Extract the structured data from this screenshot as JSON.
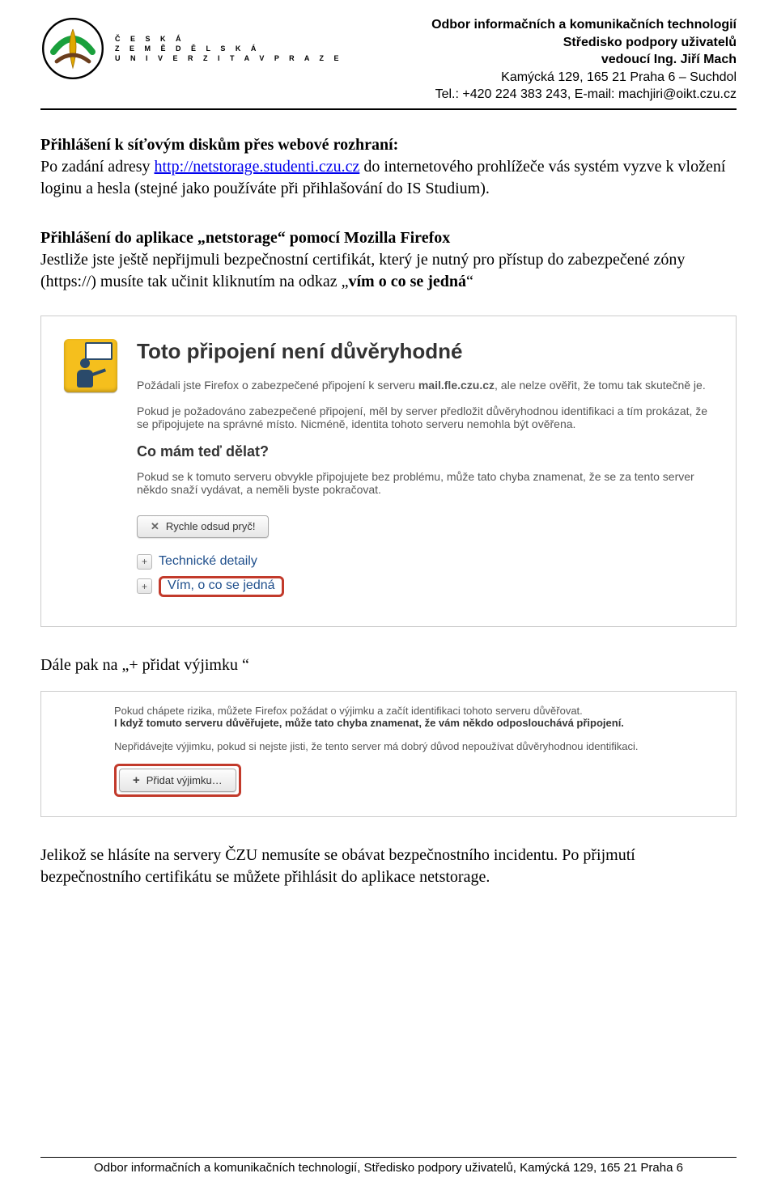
{
  "header": {
    "logo_text_line1": "Č E S K Á",
    "logo_text_line2": "Z E M Ě D Ě L S K Á",
    "logo_text_line3": "U N I V E R Z I T A  V  P R A Z E",
    "right_line1": "Odbor informačních a komunikačních technologií",
    "right_line2": "Středisko podpory uživatelů",
    "right_line3": "vedoucí Ing. Jiří Mach",
    "right_line4": "Kamýcká 129, 165 21  Praha 6 – Suchdol",
    "right_line5": "Tel.: +420 224 383 243, E-mail: machjiri@oikt.czu.cz"
  },
  "section1": {
    "title": "Přihlášení k síťovým diskům přes webové rozhraní:",
    "p1_pre": "Po zadání adresy ",
    "p1_link": "http://netstorage.studenti.czu.cz",
    "p1_post": " do internetového prohlížeče vás systém vyzve k vložení loginu a hesla (stejné jako používáte při přihlašování do IS Studium)."
  },
  "section2": {
    "title": "Přihlášení do aplikace „netstorage“ pomocí Mozilla Firefox",
    "p1_pre": "Jestliže jste ještě nepřijmuli bezpečnostní certifikát, který je nutný pro přístup do zabezpečené zóny (https://) musíte tak učinit kliknutím na odkaz „",
    "p1_bold": "vím o co se jedná",
    "p1_post": "“"
  },
  "warning": {
    "title": "Toto připojení není důvěryhodné",
    "p1_a": "Požádali jste Firefox o zabezpečené připojení k serveru ",
    "p1_server": "mail.fle.czu.cz",
    "p1_b": ", ale nelze ověřit, že tomu tak skutečně je.",
    "p2": "Pokud je požadováno zabezpečené připojení, měl by server předložit důvěryhodnou identifikaci a tím prokázat, že se připojujete na správné místo. Nicméně, identita tohoto serveru nemohla být ověřena.",
    "sub1": "Co mám teď dělat?",
    "p3": "Pokud se k tomuto serveru obvykle připojujete bez problému, může tato chyba znamenat, že se za tento server někdo snaží vydávat, a neměli byste pokračovat.",
    "btn_leave": "Rychle odsud pryč!",
    "exp1": "Technické detaily",
    "exp2": "Vím, o co se jedná"
  },
  "section3": {
    "line": "Dále pak na „+ přidat výjimku “"
  },
  "exception": {
    "p1": "Pokud chápete rizika, můžete Firefox požádat o výjimku a začít identifikaci tohoto serveru důvěřovat.",
    "p1b": "I když tomuto serveru důvěřujete, může tato chyba znamenat, že vám někdo odposlouchává připojení.",
    "p2": "Nepřidávejte výjimku, pokud si nejste jisti, že tento server má dobrý důvod nepoužívat důvěryhodnou identifikaci.",
    "btn": "Přidat výjimku…"
  },
  "section4": {
    "p": "Jelikož se hlásíte na servery ČZU nemusíte se obávat bezpečnostního incidentu. Po přijmutí bezpečnostního certifikátu se můžete přihlásit do aplikace netstorage."
  },
  "footer": {
    "text": "Odbor informačních a komunikačních technologií, Středisko podpory uživatelů, Kamýcká 129, 165 21  Praha 6"
  }
}
